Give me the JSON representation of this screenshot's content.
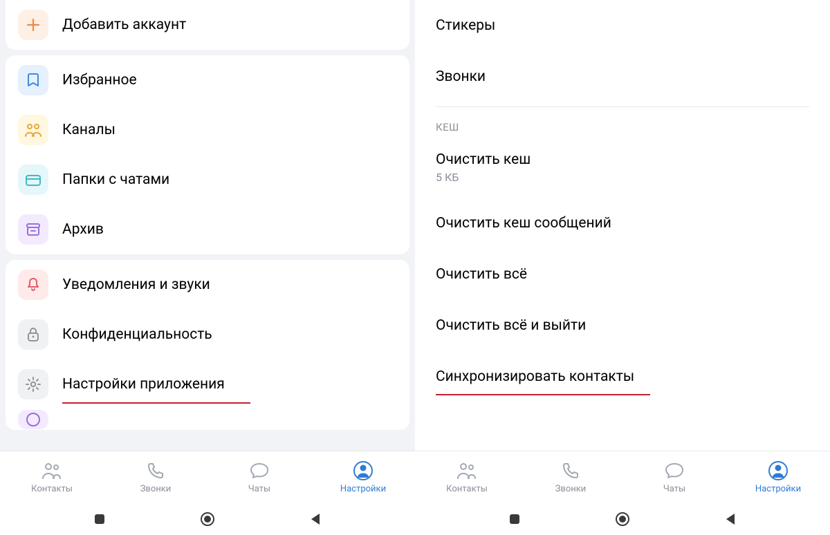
{
  "left": {
    "items": {
      "add_account": "Добавить аккаунт",
      "favorites": "Избранное",
      "channels": "Каналы",
      "chat_folders": "Папки с чатами",
      "archive": "Архив",
      "notifications": "Уведомления и звуки",
      "privacy": "Конфиденциальность",
      "app_settings": "Настройки приложения"
    }
  },
  "right": {
    "items": {
      "stickers": "Стикеры",
      "calls": "Звонки",
      "section_cache": "КЕШ",
      "clear_cache": "Очистить кеш",
      "clear_cache_size": "5 КБ",
      "clear_msg_cache": "Очистить кеш сообщений",
      "clear_all": "Очистить всё",
      "clear_all_logout": "Очистить всё и выйти",
      "sync_contacts": "Синхронизировать контакты"
    }
  },
  "tabs": {
    "contacts": "Контакты",
    "calls": "Звонки",
    "chats": "Чаты",
    "settings": "Настройки"
  }
}
